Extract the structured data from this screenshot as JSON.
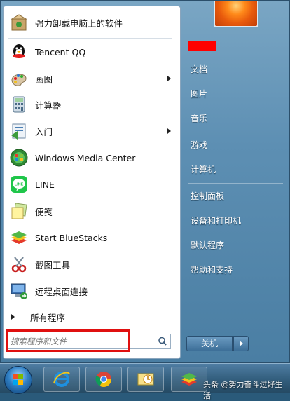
{
  "start_menu": {
    "programs": [
      {
        "label": "强力卸载电脑上的软件",
        "icon": "uninstall-box-icon",
        "has_submenu": false
      },
      {
        "label": "Tencent QQ",
        "icon": "qq-penguin-icon",
        "has_submenu": false
      },
      {
        "label": "画图",
        "icon": "paint-palette-icon",
        "has_submenu": true
      },
      {
        "label": "计算器",
        "icon": "calculator-icon",
        "has_submenu": false
      },
      {
        "label": "入门",
        "icon": "getting-started-icon",
        "has_submenu": true
      },
      {
        "label": "Windows Media Center",
        "icon": "media-center-icon",
        "has_submenu": false
      },
      {
        "label": "LINE",
        "icon": "line-app-icon",
        "has_submenu": false
      },
      {
        "label": "便笺",
        "icon": "sticky-notes-icon",
        "has_submenu": false
      },
      {
        "label": "Start BlueStacks",
        "icon": "bluestacks-icon",
        "has_submenu": false
      },
      {
        "label": "截图工具",
        "icon": "snipping-tool-icon",
        "has_submenu": false
      },
      {
        "label": "远程桌面连接",
        "icon": "remote-desktop-icon",
        "has_submenu": false
      }
    ],
    "all_programs": "所有程序",
    "search_placeholder": "搜索程序和文件",
    "right_items": [
      {
        "label": "文档"
      },
      {
        "label": "图片"
      },
      {
        "label": "音乐"
      },
      {
        "label": "游戏"
      },
      {
        "label": "计算机"
      },
      {
        "label": "控制面板"
      },
      {
        "label": "设备和打印机"
      },
      {
        "label": "默认程序"
      },
      {
        "label": "帮助和支持"
      }
    ],
    "shutdown_label": "关机"
  },
  "taskbar": {
    "items": [
      "internet-explorer-icon",
      "chrome-icon",
      "outlook-icon",
      "bluestacks-icon"
    ]
  },
  "watermark": "头条 @努力奋斗过好生活",
  "colors": {
    "highlight_red": "#e01010",
    "menu_blue": "#5d8fb3"
  }
}
